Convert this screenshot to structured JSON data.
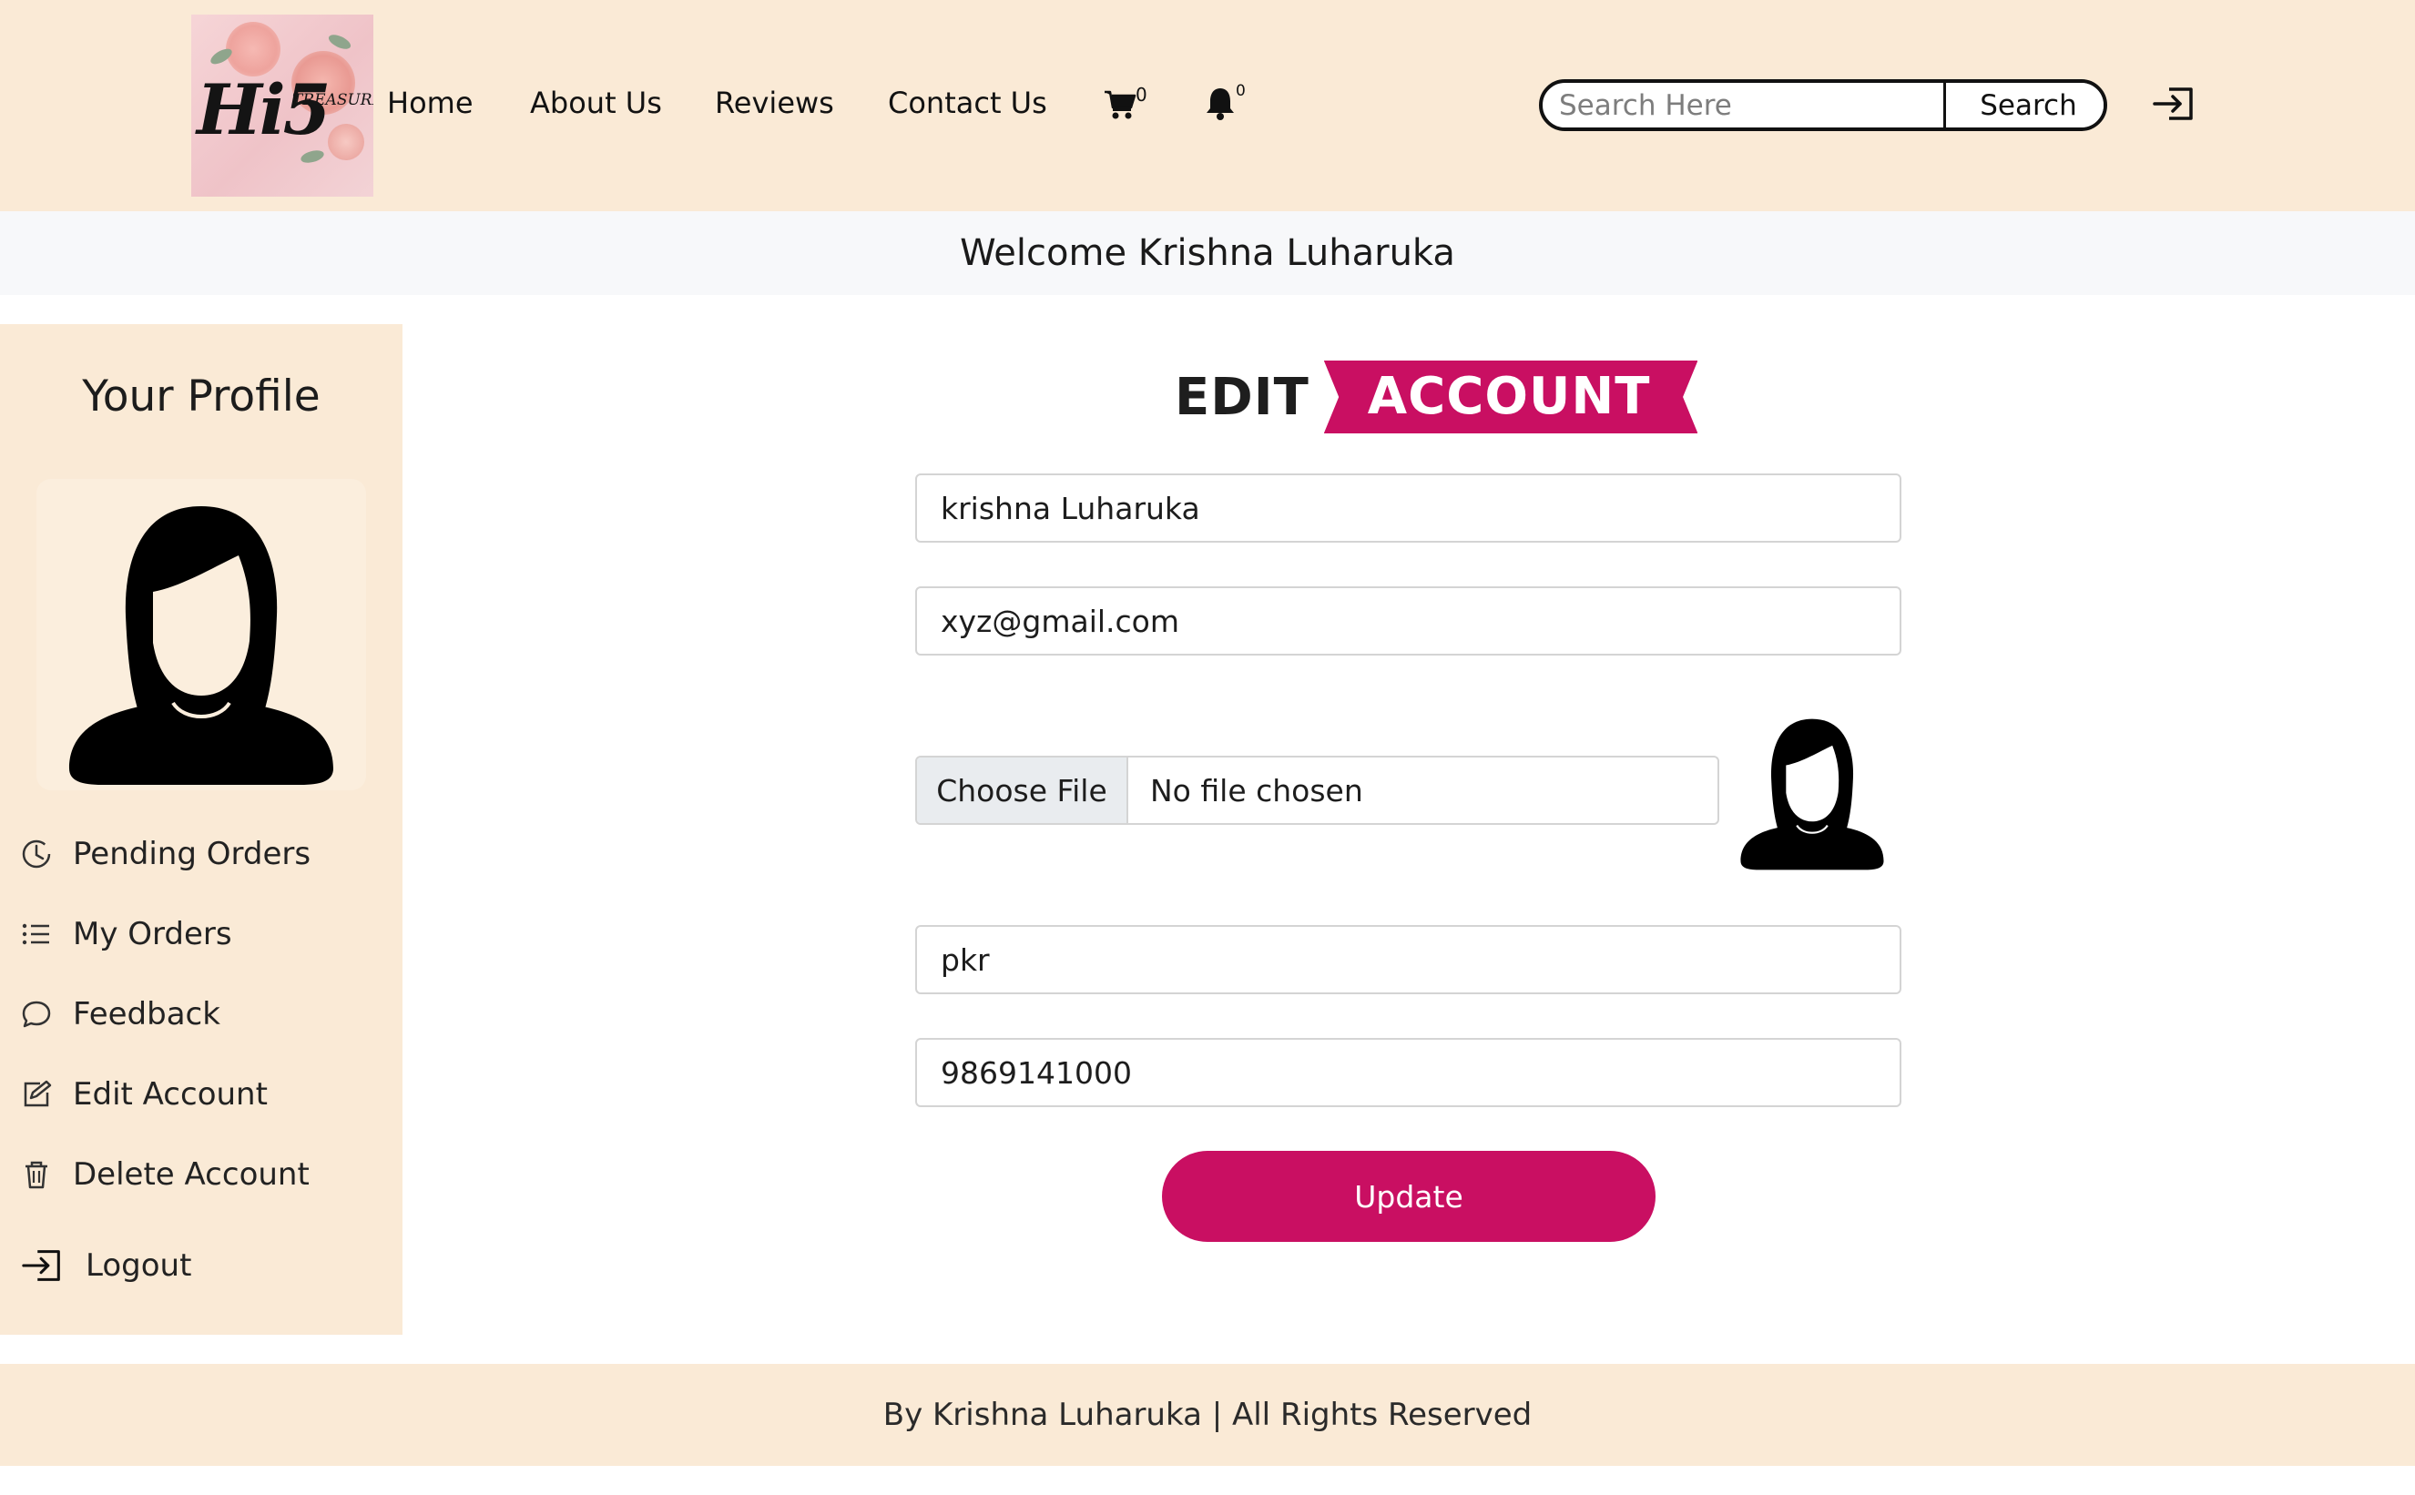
{
  "header": {
    "logo": {
      "word": "Hi5",
      "subword": "TREASURES",
      "icon": "brand-logo"
    },
    "nav": [
      {
        "label": "Home"
      },
      {
        "label": "About Us"
      },
      {
        "label": "Reviews"
      },
      {
        "label": "Contact Us"
      }
    ],
    "cart": {
      "icon": "cart-icon",
      "count": "0"
    },
    "notifications": {
      "icon": "bell-icon",
      "count": "0"
    },
    "search": {
      "placeholder": "Search Here",
      "value": "",
      "button_label": "Search"
    },
    "login_icon": "login-icon"
  },
  "welcome": {
    "text": "Welcome Krishna Luharuka"
  },
  "sidebar": {
    "title": "Your Profile",
    "avatar_icon": "user-avatar-icon",
    "items": [
      {
        "label": "Pending Orders",
        "icon": "clock-icon"
      },
      {
        "label": "My Orders",
        "icon": "list-icon"
      },
      {
        "label": "Feedback",
        "icon": "chat-icon"
      },
      {
        "label": "Edit Account",
        "icon": "edit-icon"
      },
      {
        "label": "Delete Account",
        "icon": "trash-icon"
      },
      {
        "label": "Logout",
        "icon": "logout-icon"
      }
    ]
  },
  "form": {
    "heading_plain": "EDIT",
    "heading_highlight": "ACCOUNT",
    "name": "krishna Luharuka",
    "email": "xyz@gmail.com",
    "file_button": "Choose File",
    "file_status": "No file chosen",
    "address": "pkr",
    "phone": "9869141000",
    "submit_label": "Update"
  },
  "footer": {
    "text": "By Krishna Luharuka | All Rights Reserved"
  },
  "colors": {
    "accent": "#c90f62",
    "header_bg": "#faead6",
    "welcome_bg": "#f7f8fa"
  }
}
